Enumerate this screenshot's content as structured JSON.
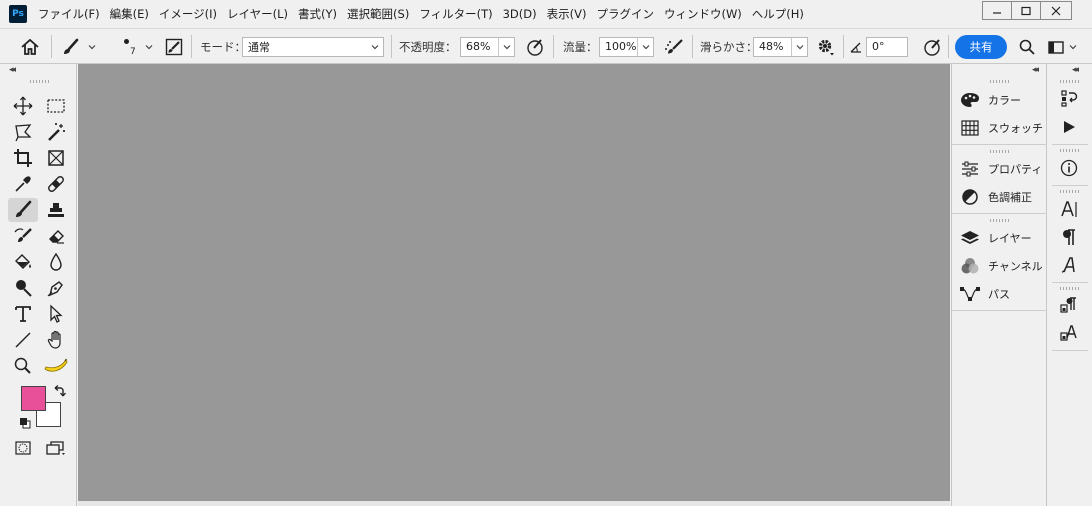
{
  "app": {
    "logo": "Ps",
    "brand_color": "#001e36",
    "logo_color": "#31a8ff"
  },
  "menu": [
    "ファイル(F)",
    "編集(E)",
    "イメージ(I)",
    "レイヤー(L)",
    "書式(Y)",
    "選択範囲(S)",
    "フィルター(T)",
    "3D(D)",
    "表示(V)",
    "プラグイン",
    "ウィンドウ(W)",
    "ヘルプ(H)"
  ],
  "window_controls": {
    "minimize": "minimize-icon",
    "maximize": "maximize-icon",
    "close": "close-icon"
  },
  "options": {
    "brush_size": "7",
    "mode_label": "モード：",
    "mode_value": "通常",
    "opacity_label": "不透明度：",
    "opacity_value": "68%",
    "flow_label": "流量：",
    "flow_value": "100%",
    "smoothing_label": "滑らかさ：",
    "smoothing_value": "48%",
    "angle_value": "0°",
    "share_label": "共有",
    "accent_color": "#1473e6"
  },
  "tools": {
    "foreground_color": "#e8509a",
    "background_color": "#ffffff",
    "selected_tool": "brush-tool"
  },
  "canvas": {
    "background_color": "#989898"
  },
  "panels": {
    "color": "カラー",
    "swatches": "スウォッチ",
    "properties": "プロパティ",
    "adjustments": "色調補正",
    "layers": "レイヤー",
    "channels": "チャンネル",
    "paths": "パス"
  }
}
